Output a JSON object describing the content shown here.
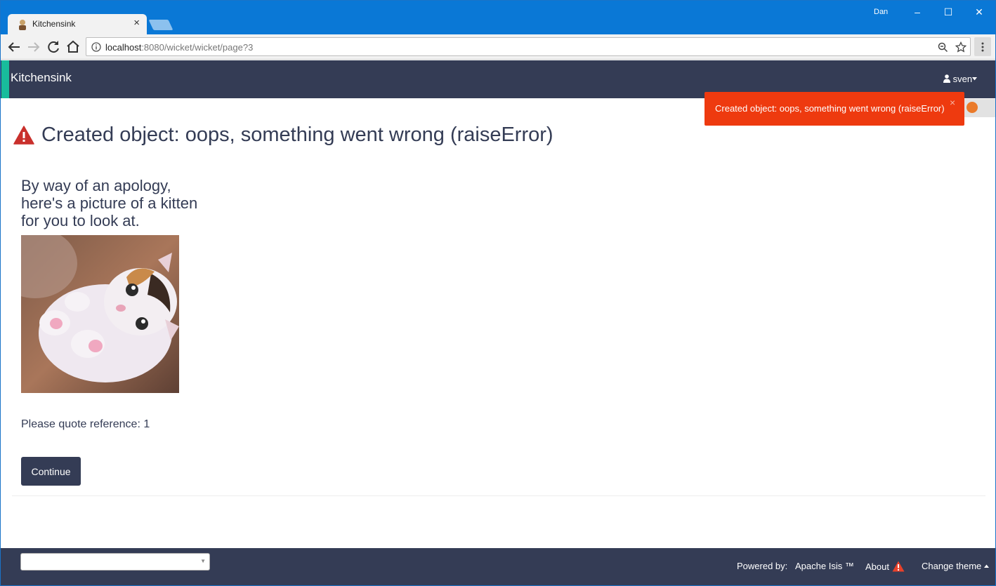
{
  "browser": {
    "tab_title": "Kitchensink",
    "tab_close": "×",
    "profile_name": "Dan",
    "url_host": "localhost",
    "url_rest": ":8080/wicket/wicket/page?3",
    "minimize": "–",
    "maximize": "☐",
    "close": "✕"
  },
  "app": {
    "brand": "Kitchensink",
    "user_menu": "sven"
  },
  "toast": {
    "message": "Created object: oops, something went wrong (raiseError)",
    "close_label": "×"
  },
  "main": {
    "title": "Created object: oops, something went wrong (raiseError)",
    "apology": "By way of an apology, here's a picture of a kitten for you to look at.",
    "reference": "Please quote reference: 1",
    "continue_label": "Continue"
  },
  "footer": {
    "select_value": "",
    "powered_by": "Powered by:",
    "framework": "Apache Isis ™",
    "about": "About",
    "change_theme": "Change theme"
  },
  "colors": {
    "navbar": "#343c55",
    "accent": "#18bc9c",
    "toast": "#ee3a0f",
    "warning_icon": "#c9302c"
  },
  "icons": [
    "back-arrow-icon",
    "forward-arrow-icon",
    "reload-icon",
    "home-icon",
    "info-icon",
    "zoom-icon",
    "star-icon",
    "menu-dots-icon",
    "user-icon",
    "caret-down-icon",
    "warning-icon",
    "caret-up-icon"
  ]
}
